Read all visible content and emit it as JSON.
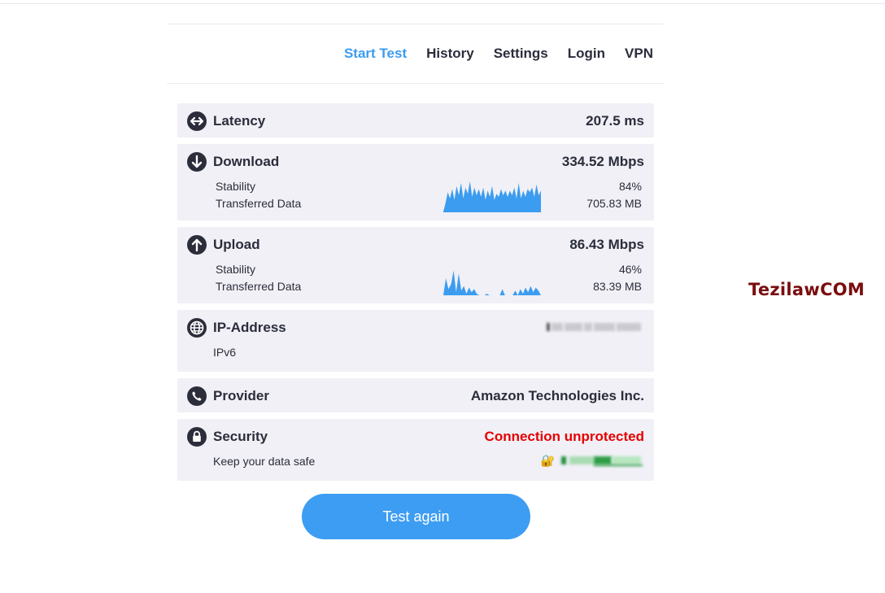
{
  "nav": {
    "items": [
      {
        "label": "Start Test",
        "active": true
      },
      {
        "label": "History"
      },
      {
        "label": "Settings"
      },
      {
        "label": "Login"
      },
      {
        "label": "VPN"
      }
    ]
  },
  "latency": {
    "title": "Latency",
    "value": "207.5 ms",
    "icon": "left-right-arrows-icon"
  },
  "download": {
    "title": "Download",
    "value": "334.52 Mbps",
    "icon": "arrow-down-icon",
    "stability_label": "Stability",
    "stability_value": "84%",
    "transferred_label": "Transferred Data",
    "transferred_value": "705.83 MB",
    "sparkline": [
      0.02,
      0.3,
      0.65,
      0.45,
      0.75,
      0.4,
      0.85,
      0.55,
      0.95,
      0.45,
      0.8,
      0.6,
      1.0,
      0.5,
      0.8,
      0.55,
      0.75,
      0.5,
      0.8,
      0.4,
      0.7,
      0.5,
      0.85,
      0.4,
      0.6,
      0.5,
      0.75,
      0.55,
      0.7,
      0.5,
      0.7,
      0.55,
      0.8,
      0.45,
      0.95,
      0.45,
      0.7,
      0.5,
      0.75,
      0.65,
      0.8,
      0.5,
      0.9,
      0.55,
      0.7
    ],
    "color": "#3b9cf0"
  },
  "upload": {
    "title": "Upload",
    "value": "86.43 Mbps",
    "icon": "arrow-up-icon",
    "stability_label": "Stability",
    "stability_value": "46%",
    "transferred_label": "Transferred Data",
    "transferred_value": "83.39 MB",
    "sparkline": [
      0.0,
      0.55,
      0.2,
      0.35,
      0.8,
      0.1,
      0.7,
      0.15,
      0.3,
      0.05,
      0.25,
      0.1,
      0.2,
      0.05,
      0.0,
      0.0,
      0.0,
      0.05,
      0.0,
      0.0,
      0.0,
      0.0,
      0.0,
      0.2,
      0.0,
      0.0,
      0.0,
      0.0,
      0.15,
      0.0,
      0.2,
      0.05,
      0.25,
      0.1,
      0.3,
      0.1,
      0.25,
      0.15,
      0.0
    ],
    "color": "#3b9cf0"
  },
  "ip": {
    "title": "IP-Address",
    "sub_label": "IPv6",
    "icon": "globe-icon"
  },
  "provider": {
    "title": "Provider",
    "value": "Amazon Technologies Inc.",
    "icon": "phone-icon"
  },
  "security": {
    "title": "Security",
    "value": "Connection unprotected",
    "value_color": "#e60000",
    "sub_label": "Keep your data safe",
    "lock_emoji": "🔐",
    "icon": "lock-icon"
  },
  "actions": {
    "test_again": "Test again"
  },
  "watermark": "TezilawCOM"
}
